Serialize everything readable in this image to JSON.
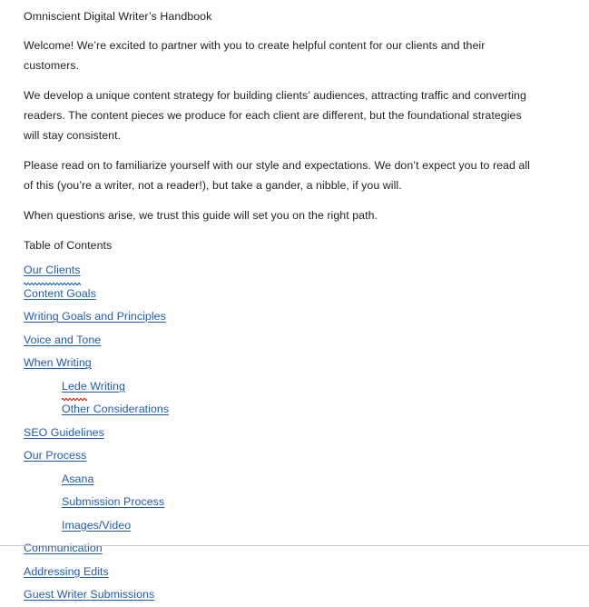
{
  "document": {
    "title": "Omniscient Digital Writer’s Handbook",
    "paragraphs": [
      "Welcome! We’re excited to partner with you to create helpful content for our clients and their customers.",
      "We develop a unique content strategy for building clients’ audiences, attracting traffic and converting readers. The content pieces we produce for each client are different, but the foundational strategies will stay consistent.",
      "Please read on to familiarize yourself with our style and expectations. We don’t expect you to read all of this (you’re a writer, not a reader!), but take a gander, a nibble, if you will.",
      "When questions arise, we trust this guide will set you on the right path."
    ],
    "toc_heading": "Table of Contents",
    "toc": [
      {
        "label": "Our Clients",
        "level": 1,
        "squiggle": "blue"
      },
      {
        "label": "Content Goals",
        "level": 1,
        "squiggle": "none"
      },
      {
        "label": "Writing Goals and Principles",
        "level": 1,
        "squiggle": "none"
      },
      {
        "label": "Voice and Tone",
        "level": 1,
        "squiggle": "none"
      },
      {
        "label": "When Writing",
        "level": 1,
        "squiggle": "none"
      },
      {
        "label": "Lede Writing",
        "level": 2,
        "squiggle": "red"
      },
      {
        "label": "Other Considerations",
        "level": 2,
        "squiggle": "none"
      },
      {
        "label": "SEO Guidelines ",
        "level": 1,
        "squiggle": "none"
      },
      {
        "label": "Our Process",
        "level": 1,
        "squiggle": "none"
      },
      {
        "label": "Asana",
        "level": 2,
        "squiggle": "none"
      },
      {
        "label": "Submission Process",
        "level": 2,
        "squiggle": "none"
      },
      {
        "label": "Images/Video",
        "level": 2,
        "squiggle": "none"
      },
      {
        "label": "Communication",
        "level": 1,
        "squiggle": "none"
      },
      {
        "label": "Addressing Edits",
        "level": 1,
        "squiggle": "none"
      },
      {
        "label": "Guest Writer Submissions",
        "level": 1,
        "squiggle": "none"
      }
    ]
  },
  "colors": {
    "link": "#1f5bb5",
    "text": "#222222",
    "background": "#ffffff",
    "divider": "#c9c9c9",
    "spelling_squiggle": "#e03024",
    "grammar_squiggle": "#2b6fd6"
  }
}
